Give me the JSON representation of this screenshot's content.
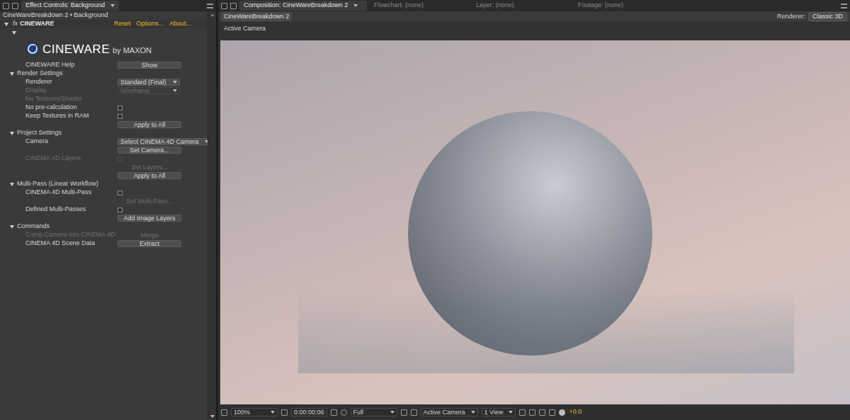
{
  "left_panel": {
    "tab": {
      "label": "Effect Controls: Background",
      "selected": true
    },
    "breadcrumb": "CineWareBreakdown 2 • Background",
    "effect": {
      "fx": "fx",
      "name": "CINEWARE",
      "expanded": true,
      "links": [
        "Reset",
        "Options...",
        "About..."
      ]
    },
    "logo": {
      "name": "CINEWARE",
      "by": "by MAXON"
    },
    "rows": [
      {
        "kind": "button",
        "label": "CINEWARE Help",
        "button": "Show",
        "disabled": false
      },
      {
        "kind": "section",
        "label": "Render Settings",
        "expanded": true
      },
      {
        "kind": "dropdown",
        "label": "Renderer",
        "value": "Standard (Final)",
        "disabled": false
      },
      {
        "kind": "dropdown",
        "label": "Display",
        "value": "Wireframe",
        "disabled": true
      },
      {
        "kind": "label",
        "label": "No Textures/Shader",
        "disabled": true
      },
      {
        "kind": "checkbox",
        "label": "No pre-calculation",
        "checked": false,
        "disabled": false
      },
      {
        "kind": "checkbox",
        "label": "Keep Textures in RAM",
        "checked": false,
        "disabled": false
      },
      {
        "kind": "action",
        "button": "Apply to All",
        "disabled": false
      },
      {
        "kind": "section",
        "label": "Project Settings",
        "expanded": true
      },
      {
        "kind": "dropdown",
        "label": "Camera",
        "value": "Select CINEMA 4D Camera",
        "disabled": false
      },
      {
        "kind": "action",
        "button": "Set Camera...",
        "disabled": false
      },
      {
        "kind": "checkbox",
        "label": "CINEMA 4D Layers",
        "checked": false,
        "disabled": true
      },
      {
        "kind": "action",
        "button": "Set Layers...",
        "disabled": true
      },
      {
        "kind": "action",
        "button": "Apply to All",
        "disabled": false
      },
      {
        "kind": "section",
        "label": "Multi-Pass (Linear Workflow)",
        "expanded": true
      },
      {
        "kind": "checkbox",
        "label": "CINEMA 4D Multi-Pass",
        "checked": false,
        "disabled": false
      },
      {
        "kind": "action",
        "button": "Set Multi-Pass...",
        "disabled": true
      },
      {
        "kind": "checkbox",
        "label": "Defined Multi-Passes",
        "checked": false,
        "disabled": false
      },
      {
        "kind": "action",
        "button": "Add Image Layers",
        "disabled": false
      },
      {
        "kind": "section",
        "label": "Commands",
        "expanded": true
      },
      {
        "kind": "button",
        "label": "Comp Camera into CINEMA 4D",
        "button": "Merge",
        "disabled": true
      },
      {
        "kind": "button",
        "label": "CINEMA 4D Scene Data",
        "button": "Extract",
        "disabled": false
      }
    ]
  },
  "right_panel": {
    "tabs": [
      {
        "label": "Composition: CineWareBreakdown 2",
        "selected": true
      },
      {
        "label": "Flowchart: (none)",
        "selected": false
      },
      {
        "label": "Layer: (none)",
        "selected": false
      },
      {
        "label": "Footage: (none)",
        "selected": false
      }
    ],
    "comp_tab": "CineWareBreakdown 2",
    "renderer_label": "Renderer:",
    "renderer_value": "Classic 3D",
    "view_label": "Active Camera",
    "toolbar": {
      "zoom": "100%",
      "timecode": "0:00:00:06",
      "resolution": "Full",
      "camera": "Active Camera",
      "views": "1 View",
      "exposure": "+0.0"
    }
  }
}
